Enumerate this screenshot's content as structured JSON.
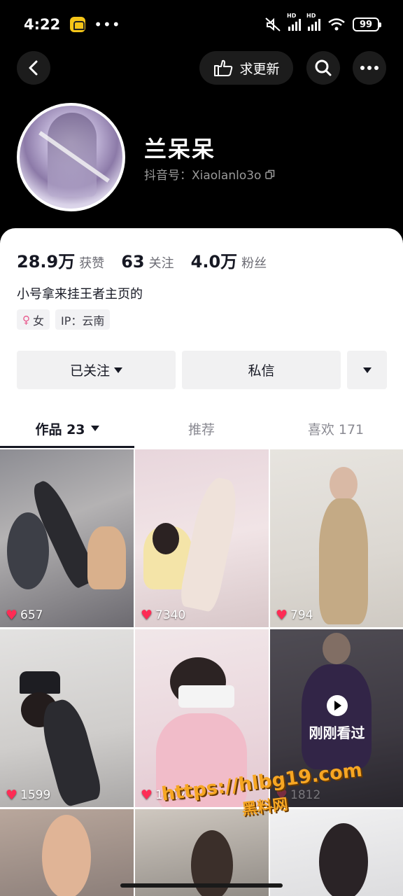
{
  "status_bar": {
    "time": "4:22",
    "battery": "99",
    "icons": [
      "app-badge-icon",
      "mute-icon",
      "signal-icon",
      "signal-icon",
      "wifi-icon",
      "battery-icon"
    ]
  },
  "nav": {
    "request_update_label": "求更新",
    "icons": [
      "back-icon",
      "hand-point-icon",
      "search-icon",
      "more-icon"
    ]
  },
  "profile": {
    "nickname": "兰呆呆",
    "douyin_id": "抖音号：Xiaolanlo3o",
    "stats": [
      {
        "value": "28.9万",
        "label": "获赞"
      },
      {
        "value": "63",
        "label": "关注"
      },
      {
        "value": "4.0万",
        "label": "粉丝"
      }
    ],
    "bio": "小号拿来挂王者主页的",
    "tags": {
      "gender": "女",
      "ip": "IP：云南"
    }
  },
  "actions": {
    "followed_label": "已关注",
    "message_label": "私信"
  },
  "tabs": [
    {
      "label": "作品 23",
      "active": true
    },
    {
      "label": "推荐",
      "active": false
    },
    {
      "label": "喜欢 171",
      "active": false
    }
  ],
  "videos": [
    {
      "likes": "657"
    },
    {
      "likes": "7340"
    },
    {
      "likes": "794"
    },
    {
      "likes": "1599"
    },
    {
      "likes": "1412"
    },
    {
      "likes": "1812",
      "overlay": "刚刚看过"
    },
    {
      "likes": ""
    },
    {
      "likes": ""
    },
    {
      "likes": ""
    }
  ],
  "watermark": {
    "url": "https://hlbg19.com",
    "name": "黑料网"
  },
  "colors": {
    "like_heart": "#fe2c55",
    "sheet_bg": "#ffffff",
    "button_bg": "#f1f1f2"
  }
}
